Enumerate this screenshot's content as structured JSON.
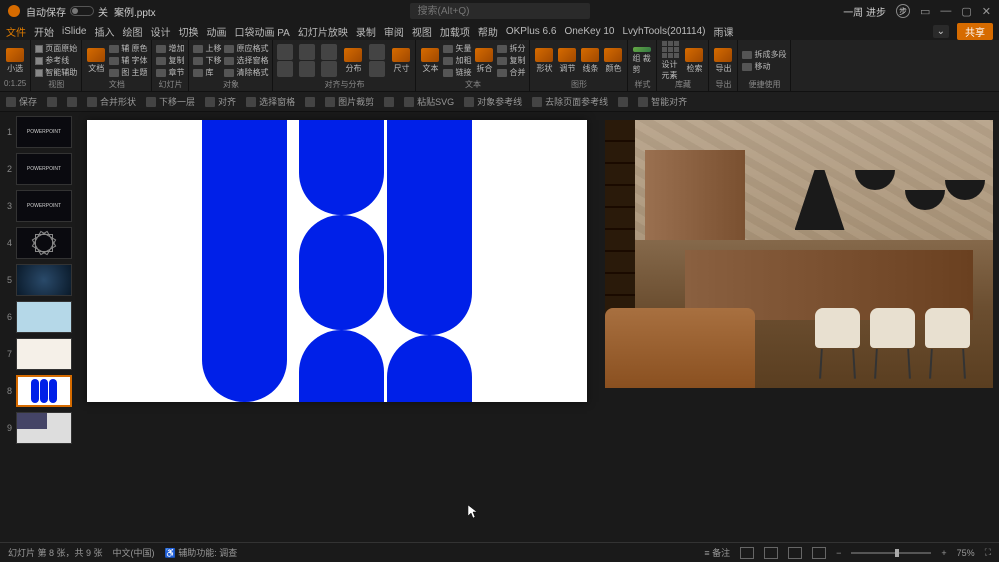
{
  "titlebar": {
    "autosave_label": "自动保存",
    "autosave_state": "关",
    "filename": "案例.pptx",
    "search_placeholder": "搜索(Alt+Q)",
    "user_name": "一周 进步"
  },
  "tabs": {
    "items": [
      "文件",
      "开始",
      "iSlide",
      "插入",
      "绘图",
      "设计",
      "切换",
      "动画",
      "口袋动画 PA",
      "幻灯片放映",
      "录制",
      "审阅",
      "视图",
      "加载项",
      "帮助",
      "OKPlus 6.6",
      "OneKey 10",
      "LvyhTools(201114)",
      "雨课"
    ],
    "share": "共享"
  },
  "ribbon": {
    "g0": {
      "btn": "小选",
      "size": "0:1.25"
    },
    "g1": {
      "label": "视图",
      "items": [
        "页面原始",
        "参考线",
        "智能辅助"
      ]
    },
    "g2": {
      "label": "文档",
      "btn": "文档",
      "rows": [
        "辅 原色",
        "辅 字体",
        "图 主题"
      ]
    },
    "g3": {
      "label": "幻灯片",
      "r1": "增加",
      "r2": "复制",
      "r3": "章节"
    },
    "g4": {
      "label": "对象",
      "r1": "上移",
      "r2": "下移",
      "r3": "库"
    },
    "g5": {
      "r1": "原应格式",
      "r2": "选择窗格",
      "r3": "清除格式"
    },
    "g6": {
      "label": "对齐与分布",
      "btn": "分布",
      "btn2": "尺寸"
    },
    "g7": {
      "label": "文本",
      "btn": "文本",
      "r1": "矢量",
      "r2": "加粗",
      "r3": "链接"
    },
    "g8": {
      "btn": "拆合",
      "r1": "拆分",
      "r2": "复制",
      "r3": "合并"
    },
    "g9": {
      "label": "图形",
      "b1": "形状",
      "b2": "调节",
      "b3": "线条",
      "b4": "颜色"
    },
    "g10": {
      "label": "样式",
      "btn": "组 裁剪"
    },
    "g11": {
      "label": "库藏",
      "b1": "设计元素",
      "b2": "检索"
    },
    "g12": {
      "label": "导出",
      "btn": "导出"
    },
    "g13": {
      "label": "便捷使用",
      "b1": "拆成多段",
      "b2": "移动"
    }
  },
  "subbar": {
    "items": [
      "保存",
      "",
      "",
      "合并形状",
      "下移一层",
      "对齐",
      "选择窗格",
      "",
      "图片裁剪",
      "",
      "粘贴SVG",
      "对象参考线",
      "去除页面参考线",
      "",
      "智能对齐"
    ]
  },
  "thumbs": {
    "count": 9,
    "selected": 8
  },
  "statusbar": {
    "slide_info": "幻灯片 第 8 张，共 9 张",
    "lang": "中文(中国)",
    "access": "辅助功能: 调查",
    "notes": "备注",
    "zoom": "75%"
  }
}
